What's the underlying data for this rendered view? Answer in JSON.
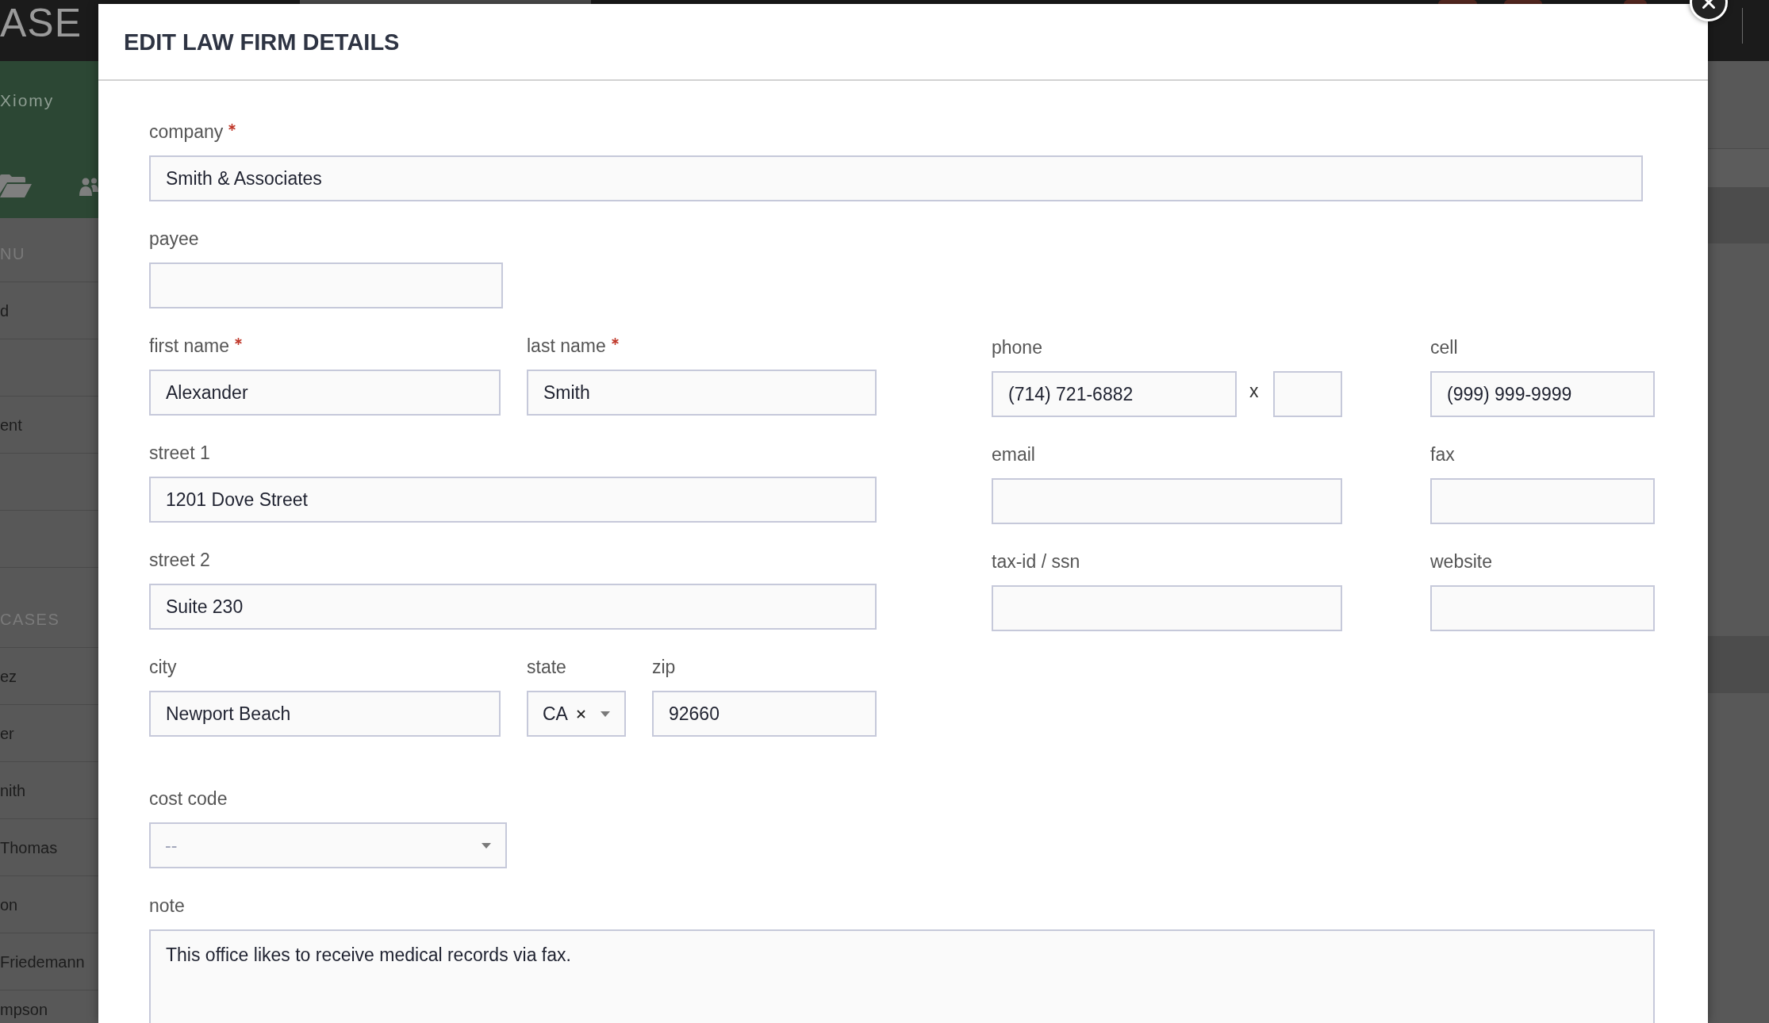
{
  "sidebar": {
    "logo": "ASE",
    "user_name": "Xiomy",
    "sections": [
      {
        "heading": "NU",
        "items": [
          {
            "kind": "entry",
            "label": "d"
          },
          {
            "kind": "blank"
          },
          {
            "kind": "entry",
            "label": "ent"
          },
          {
            "kind": "blank"
          },
          {
            "kind": "blank"
          }
        ]
      },
      {
        "heading": "CASES",
        "items": [
          {
            "kind": "entry",
            "label": "ez"
          },
          {
            "kind": "entry",
            "label": "er"
          },
          {
            "kind": "entry",
            "label": "nith"
          },
          {
            "kind": "entry",
            "label": "Thomas"
          },
          {
            "kind": "entry",
            "label": "on"
          },
          {
            "kind": "entry",
            "label": "Friedemann"
          },
          {
            "kind": "entry",
            "label": "mpson"
          }
        ]
      }
    ]
  },
  "modal": {
    "title": "EDIT LAW FIRM DETAILS",
    "top_fields": [
      {
        "kind": "text",
        "label": "company",
        "required": true,
        "value": "Smith & Associates"
      },
      {
        "kind": "text",
        "label": "payee",
        "required": false
      }
    ],
    "left_rows": [
      {
        "fields": [
          {
            "kind": "text",
            "label": "first name",
            "required": true,
            "value": "Alexander"
          },
          {
            "kind": "text",
            "label": "last name",
            "required": true,
            "value": "Smith"
          }
        ]
      },
      {
        "fields": [
          {
            "kind": "text",
            "label": "street 1",
            "required": false,
            "value": "1201 Dove Street"
          }
        ]
      },
      {
        "fields": [
          {
            "kind": "text",
            "label": "street 2",
            "required": false,
            "value": "Suite 230"
          }
        ]
      },
      {
        "fields": [
          {
            "kind": "text",
            "label": "city",
            "required": false,
            "value": "Newport Beach"
          },
          {
            "kind": "select",
            "label": "state",
            "required": false,
            "value": "CA"
          },
          {
            "kind": "text",
            "label": "zip",
            "required": false,
            "value": "92660"
          }
        ]
      }
    ],
    "right_rows": [
      {
        "fields": [
          {
            "kind": "phone",
            "label": "phone",
            "required": false,
            "value": "(714) 721-6882",
            "extension_separator": "x"
          },
          {
            "kind": "text",
            "label": "cell",
            "required": false,
            "value": "(999) 999-9999"
          }
        ]
      },
      {
        "fields": [
          {
            "kind": "text",
            "label": "email",
            "required": false
          },
          {
            "kind": "text",
            "label": "fax",
            "required": false
          }
        ]
      },
      {
        "fields": [
          {
            "kind": "text",
            "label": "tax-id / ssn",
            "required": false
          },
          {
            "kind": "text",
            "label": "website",
            "required": false
          }
        ]
      }
    ],
    "bottom_fields": [
      {
        "kind": "select",
        "label": "cost code",
        "required": false,
        "placeholder": "--"
      },
      {
        "kind": "textarea",
        "label": "note",
        "required": false,
        "value": "This office likes to receive medical records via fax."
      }
    ]
  }
}
